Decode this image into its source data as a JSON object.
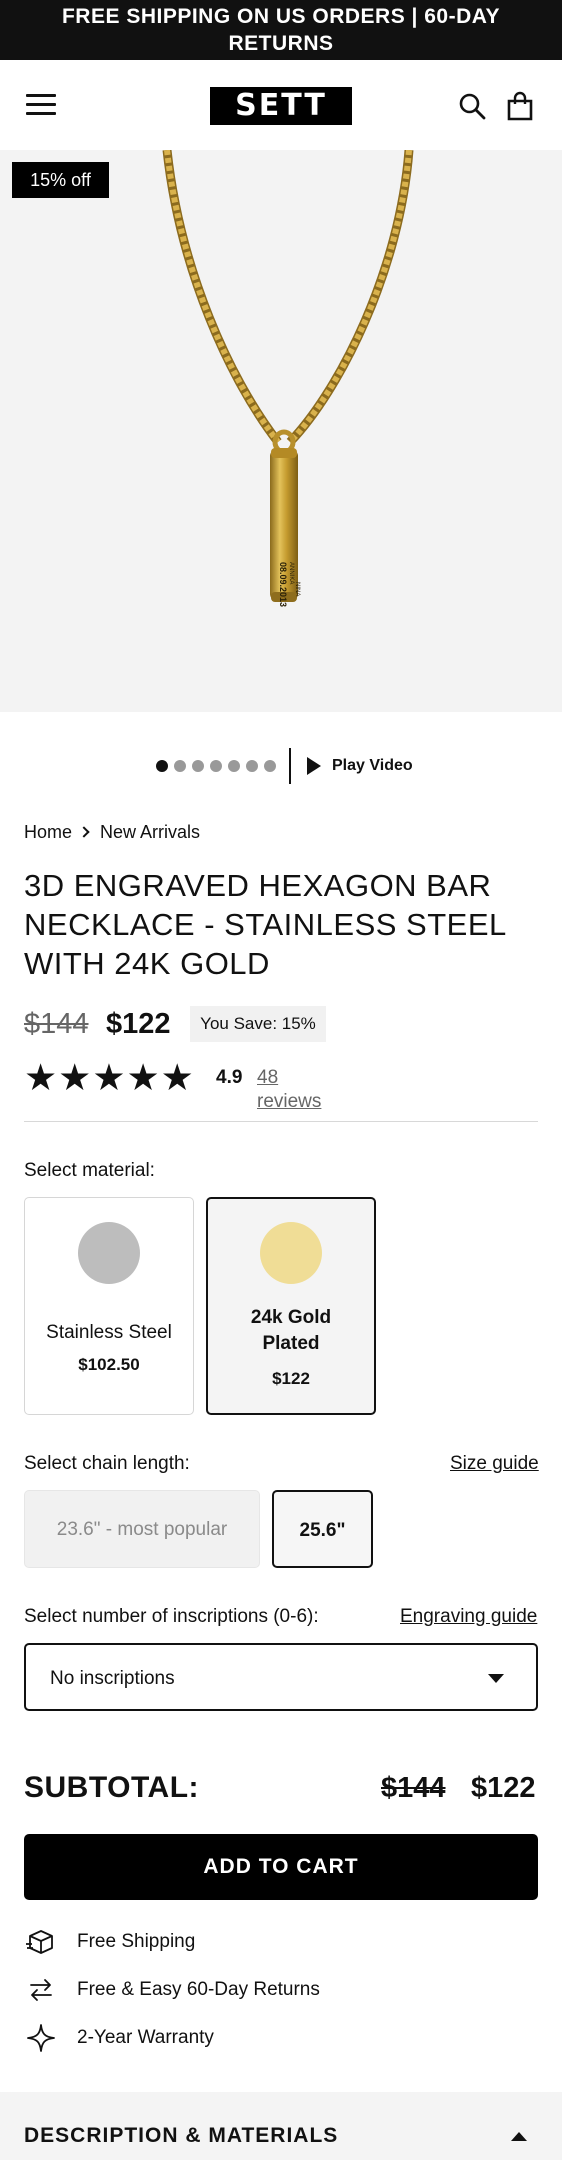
{
  "announcement": "FREE SHIPPING ON US ORDERS | 60-DAY RETURNS",
  "header": {
    "logo_text": "SETT",
    "icons": [
      "menu-icon",
      "search-icon",
      "bag-icon"
    ]
  },
  "hero": {
    "discount_badge": "15% off",
    "engraving_line1": "08.09.2013",
    "engraving_line2": "ANNIKA",
    "engraving_line3": "NINA"
  },
  "gallery": {
    "dot_count": 7,
    "active_dot": 1,
    "play_label": "Play Video"
  },
  "breadcrumb": {
    "home": "Home",
    "current": "New Arrivals"
  },
  "product": {
    "title": "3D ENGRAVED HEXAGON BAR NECKLACE - STAINLESS STEEL WITH 24K GOLD",
    "old_price": "$144",
    "price": "$122",
    "save_label": "You Save: 15%",
    "stars": "★★★★★",
    "rating": "4.9",
    "reviews": "48 reviews"
  },
  "material": {
    "label": "Select material:",
    "options": [
      {
        "name": "Stainless Steel",
        "price": "$102.50",
        "swatch": "#bdbdbd",
        "selected": false
      },
      {
        "name_line1": "24k Gold",
        "name_line2": "Plated",
        "price": "$122",
        "swatch": "#f0dd96",
        "selected": true
      }
    ]
  },
  "chain": {
    "label": "Select chain length:",
    "size_guide": "Size guide",
    "options": [
      {
        "label": "23.6\" - most popular",
        "selected": false
      },
      {
        "label": "25.6\"",
        "selected": true
      }
    ]
  },
  "inscriptions": {
    "label": "Select number of inscriptions (0-6):",
    "guide": "Engraving guide",
    "value": "No inscriptions"
  },
  "subtotal": {
    "label": "SUBTOTAL:",
    "old": "$144",
    "new": "$122"
  },
  "cart_button": "ADD TO CART",
  "perks": [
    {
      "icon": "box-icon",
      "text": "Free Shipping"
    },
    {
      "icon": "arrows-icon",
      "text": "Free & Easy 60-Day Returns"
    },
    {
      "icon": "sparkle-icon",
      "text": "2-Year Warranty"
    }
  ],
  "accordion": {
    "title": "DESCRIPTION & MATERIALS"
  },
  "colors": {
    "dark": "#111111",
    "hero_bg": "#f3f3f3",
    "gold": "#c8a43a"
  }
}
